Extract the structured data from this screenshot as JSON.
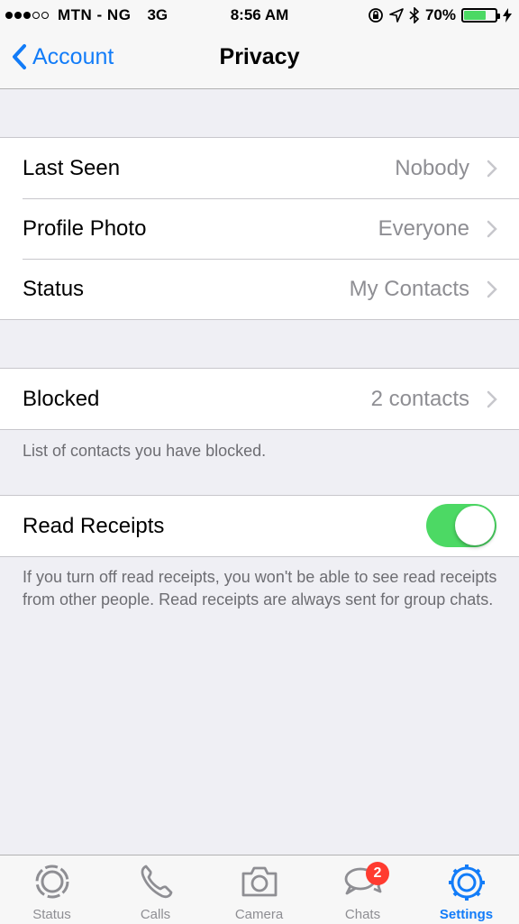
{
  "status_bar": {
    "carrier": "MTN - NG",
    "network": "3G",
    "time": "8:56 AM",
    "battery_percent": "70%",
    "battery_level": 0.7
  },
  "nav": {
    "back_label": "Account",
    "title": "Privacy"
  },
  "privacy_rows": [
    {
      "label": "Last Seen",
      "value": "Nobody"
    },
    {
      "label": "Profile Photo",
      "value": "Everyone"
    },
    {
      "label": "Status",
      "value": "My Contacts"
    }
  ],
  "blocked": {
    "label": "Blocked",
    "value": "2 contacts",
    "footnote": "List of contacts you have blocked."
  },
  "read_receipts": {
    "label": "Read Receipts",
    "enabled": true,
    "footnote": "If you turn off read receipts, you won't be able to see read receipts from other people. Read receipts are always sent for group chats."
  },
  "tabs": [
    {
      "label": "Status",
      "icon": "status-icon",
      "active": false
    },
    {
      "label": "Calls",
      "icon": "phone-icon",
      "active": false
    },
    {
      "label": "Camera",
      "icon": "camera-icon",
      "active": false
    },
    {
      "label": "Chats",
      "icon": "chats-icon",
      "active": false,
      "badge": "2"
    },
    {
      "label": "Settings",
      "icon": "gear-icon",
      "active": true
    }
  ],
  "colors": {
    "accent": "#127cf8",
    "toggle_on": "#4cd964",
    "badge": "#ff3b30",
    "background": "#efeff4"
  }
}
